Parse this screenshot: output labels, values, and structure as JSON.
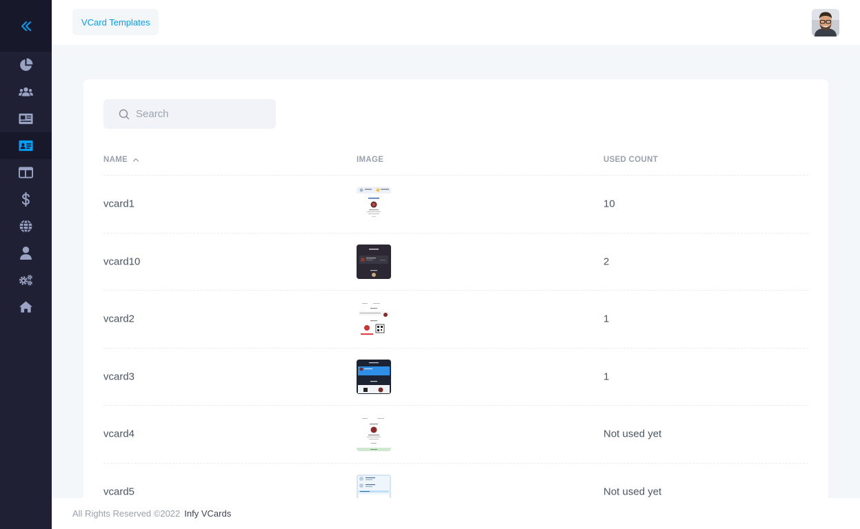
{
  "header": {
    "tab_label": "VCard Templates"
  },
  "sidebar": {
    "items": [
      {
        "icon": "pie-chart-icon"
      },
      {
        "icon": "users-icon"
      },
      {
        "icon": "newspaper-icon"
      },
      {
        "icon": "id-card-icon",
        "active": true
      },
      {
        "icon": "layout-icon"
      },
      {
        "icon": "dollar-icon"
      },
      {
        "icon": "globe-icon"
      },
      {
        "icon": "user-icon"
      },
      {
        "icon": "gears-icon"
      },
      {
        "icon": "home-icon"
      }
    ]
  },
  "search": {
    "placeholder": "Search"
  },
  "table": {
    "columns": [
      "NAME",
      "IMAGE",
      "USED COUNT"
    ],
    "rows": [
      {
        "name": "vcard1",
        "count": "10"
      },
      {
        "name": "vcard10",
        "count": "2"
      },
      {
        "name": "vcard2",
        "count": "1"
      },
      {
        "name": "vcard3",
        "count": "1"
      },
      {
        "name": "vcard4",
        "count": "Not used yet"
      },
      {
        "name": "vcard5",
        "count": "Not used yet"
      }
    ]
  },
  "footer": {
    "copyright": "All Rights Reserved ©2022",
    "brand": "Infy VCards"
  },
  "colors": {
    "accent": "#009ef7",
    "sidebar_bg": "#1f2033",
    "sidebar_icon": "#9aa3c4"
  }
}
